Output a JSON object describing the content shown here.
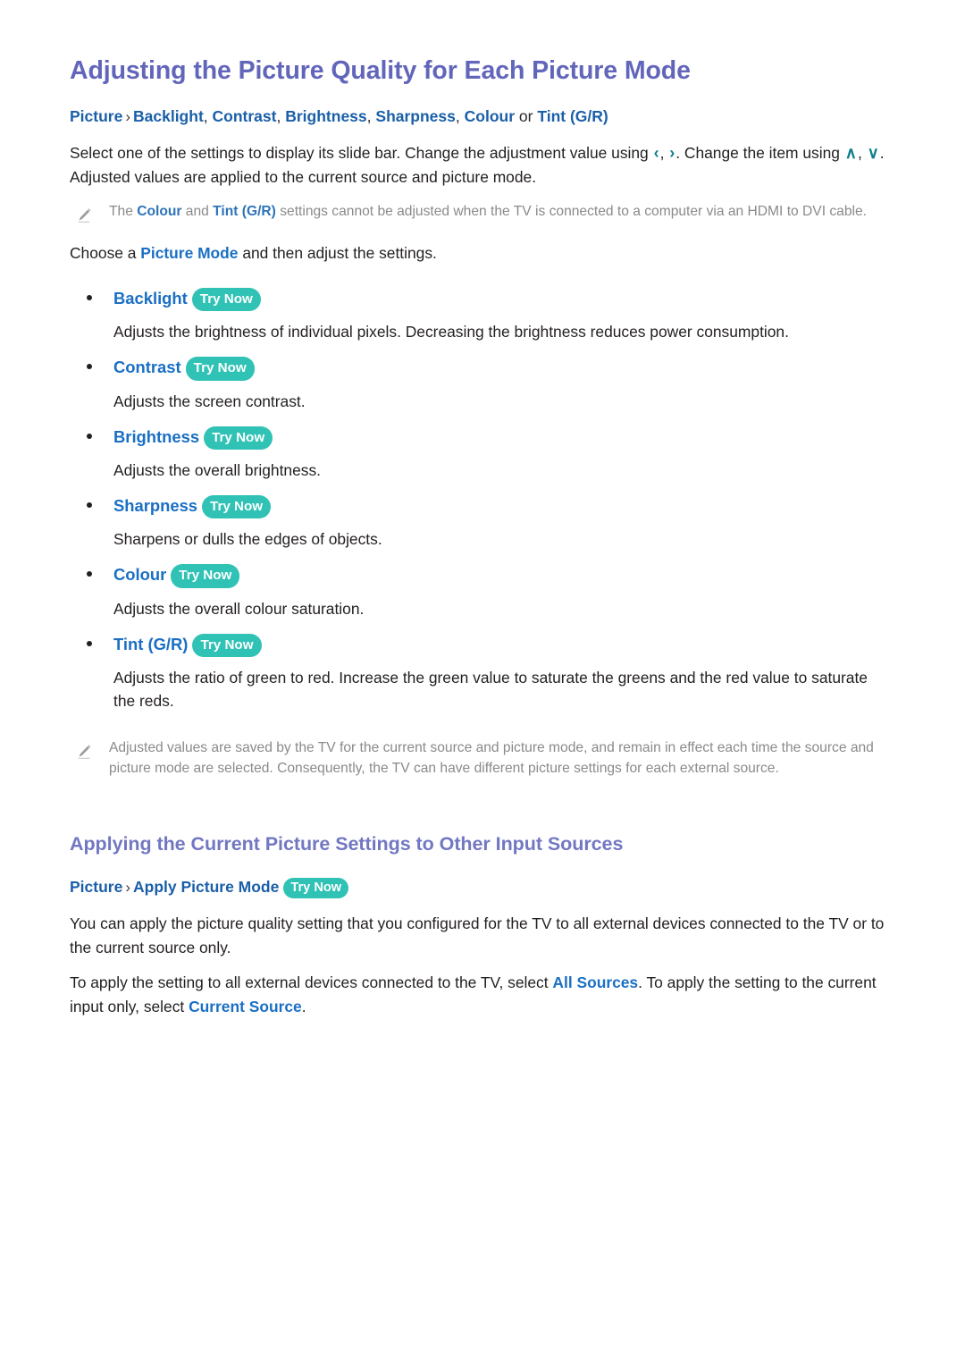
{
  "document": {
    "title": "Adjusting the Picture Quality for Each Picture Mode"
  },
  "colors": {
    "heading_purple": "#6266bb",
    "section_purple": "#7277c2",
    "link_blue": "#1a6fc4",
    "breadcrumb_blue": "#1a5fa8",
    "badge_teal": "#2fc2b5",
    "nav_glyph_teal": "#11808f",
    "note_gray": "#8a8a8a",
    "body_black": "#231f20"
  },
  "breadcrumb1": {
    "root": "Picture",
    "separator": "›",
    "items": [
      "Backlight",
      "Contrast",
      "Brightness",
      "Sharpness",
      "Colour"
    ],
    "conjunction": "or",
    "last": "Tint (G/R)",
    "comma": ","
  },
  "intro": {
    "part1": "Select one of the settings to display its slide bar. Change the adjustment value using ",
    "glyph_left": "‹",
    "glyph_comma": ", ",
    "glyph_right": "›",
    "part2": ". Change the item using ",
    "glyph_up": "∧",
    "glyph_down": "∨",
    "part3": ". Adjusted values are applied to the current source and picture mode."
  },
  "note1": {
    "icon": "pencil-icon",
    "part1": "The ",
    "kw1": "Colour",
    "part2": " and ",
    "kw2": "Tint (G/R)",
    "part3": " settings cannot be adjusted when the TV is connected to a computer via an HDMI to DVI cable."
  },
  "choose_line": {
    "part1": "Choose a ",
    "kw": "Picture Mode",
    "part2": " and then adjust the settings."
  },
  "badge_label": "Try Now",
  "bullets": [
    {
      "label": "Backlight",
      "badge": "Try Now",
      "description": "Adjusts the brightness of individual pixels. Decreasing the brightness reduces power consumption."
    },
    {
      "label": "Contrast",
      "badge": "Try Now",
      "description": "Adjusts the screen contrast."
    },
    {
      "label": "Brightness",
      "badge": "Try Now",
      "description": "Adjusts the overall brightness."
    },
    {
      "label": "Sharpness",
      "badge": "Try Now",
      "description": "Sharpens or dulls the edges of objects."
    },
    {
      "label": "Colour",
      "badge": "Try Now",
      "description": "Adjusts the overall colour saturation."
    },
    {
      "label": "Tint (G/R)",
      "badge": "Try Now",
      "description": "Adjusts the ratio of green to red. Increase the green value to saturate the greens and the red value to saturate the reds."
    }
  ],
  "note2": {
    "icon": "pencil-icon",
    "text": "Adjusted values are saved by the TV for the current source and picture mode, and remain in effect each time the source and picture mode are selected. Consequently, the TV can have different picture settings for each external source."
  },
  "section2": {
    "title": "Applying the Current Picture Settings to Other Input Sources",
    "breadcrumb": {
      "root": "Picture",
      "separator": "›",
      "item": "Apply Picture Mode",
      "badge": "Try Now"
    },
    "paragraph1": "You can apply the picture quality setting that you configured for the TV to all external devices connected to the TV or to the current source only.",
    "paragraph2": {
      "part1": "To apply the setting to all external devices connected to the TV, select ",
      "kw1": "All Sources",
      "part2": ". To apply the setting to the current input only, select ",
      "kw2": "Current Source",
      "part3": "."
    }
  }
}
